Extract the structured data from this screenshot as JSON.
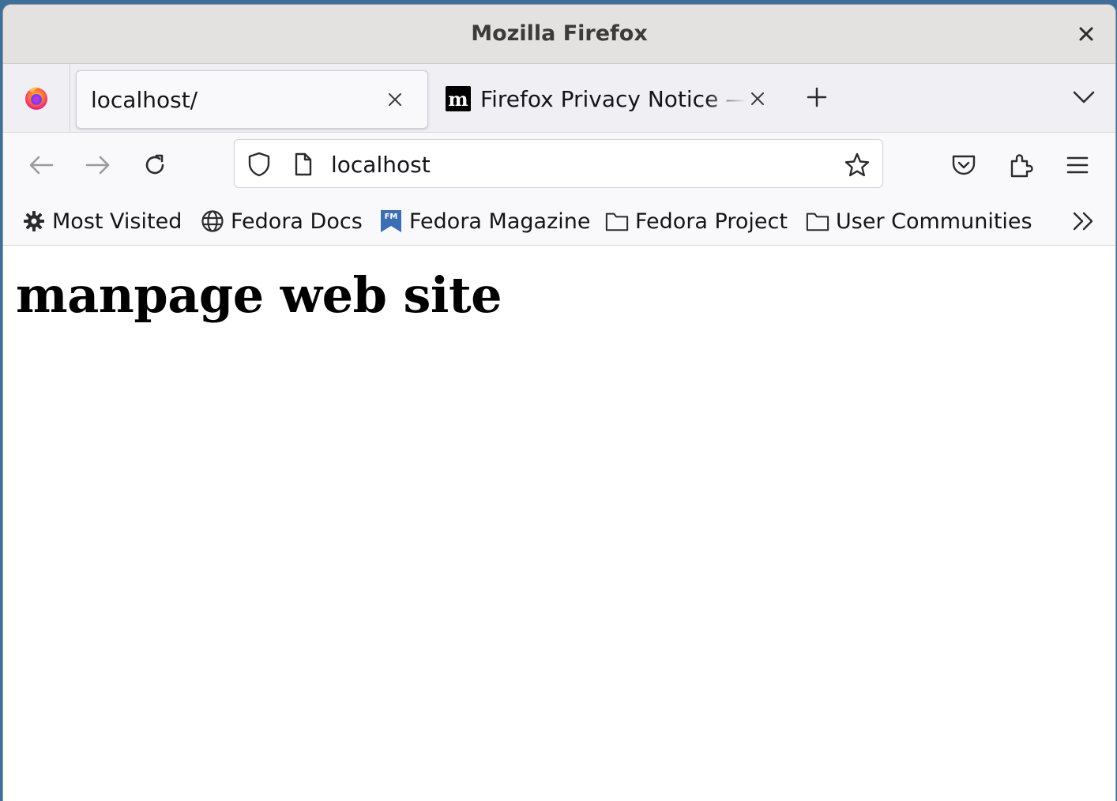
{
  "window": {
    "title": "Mozilla Firefox"
  },
  "tabs": [
    {
      "label": "localhost/",
      "active": true
    },
    {
      "label": "Firefox Privacy Notice — Mozilla",
      "favicon": "mozilla-m-icon",
      "active": false
    }
  ],
  "urlbar": {
    "value": "localhost"
  },
  "bookmarks": [
    {
      "label": "Most Visited",
      "icon": "gear-icon"
    },
    {
      "label": "Fedora Docs",
      "icon": "globe-icon"
    },
    {
      "label": "Fedora Magazine",
      "icon": "fedora-magazine-icon"
    },
    {
      "label": "Fedora Project",
      "icon": "folder-icon"
    },
    {
      "label": "User Communities",
      "icon": "folder-icon"
    }
  ],
  "page": {
    "heading": "manpage web site"
  },
  "colors": {
    "desktop": "#3d6f9a",
    "titlebar": "#e3e2e0",
    "tabstrip": "#f0f0f4",
    "toolbar": "#f9f9fb"
  }
}
